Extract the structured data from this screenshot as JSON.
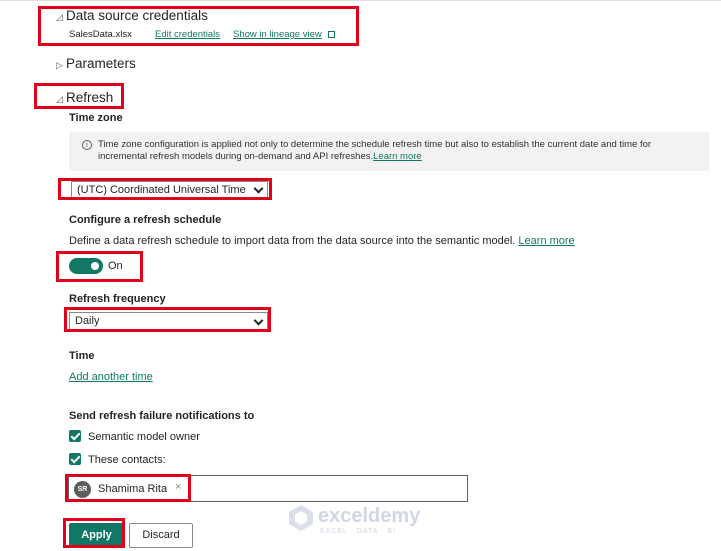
{
  "credentials": {
    "title": "Data source credentials",
    "filename": "SalesData.xlsx",
    "edit_link": "Edit credentials",
    "lineage_link": "Show in lineage view"
  },
  "parameters": {
    "title": "Parameters"
  },
  "refresh": {
    "title": "Refresh",
    "time_zone_label": "Time zone",
    "info_text": "Time zone configuration is applied not only to determine the schedule refresh time but also to establish the current date and time for incremental refresh models during on-demand and API refreshes.",
    "info_link": "Learn more",
    "time_zone_value": "(UTC) Coordinated Universal Time",
    "schedule_label": "Configure a refresh schedule",
    "schedule_desc": "Define a data refresh schedule to import data from the data source into the semantic model.",
    "schedule_link": "Learn more",
    "toggle_label": "On",
    "frequency_label": "Refresh frequency",
    "frequency_value": "Daily",
    "time_label": "Time",
    "add_time_link": "Add another time",
    "notify_label": "Send refresh failure notifications to",
    "owner_checkbox_label": "Semantic model owner",
    "contacts_checkbox_label": "These contacts:",
    "contact": {
      "initials": "SR",
      "name": "Shamima Rita"
    },
    "apply_label": "Apply",
    "discard_label": "Discard"
  },
  "watermark": {
    "name": "exceldemy",
    "sub": "EXCEL · DATA · BI"
  },
  "colors": {
    "accent": "#117865",
    "highlight_box": "#e0001b"
  }
}
